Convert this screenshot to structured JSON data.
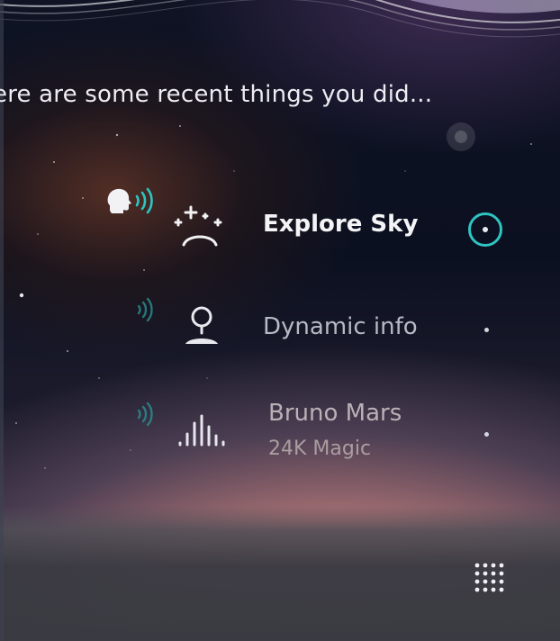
{
  "heading": "ere are some recent things you did...",
  "items": [
    {
      "title": "Explore Sky",
      "icon": "sparkle-smile-icon",
      "active": true
    },
    {
      "title": "Dynamic info",
      "icon": "location-pin-icon",
      "active": false
    },
    {
      "title": "Bruno Mars",
      "subtitle": "24K Magic",
      "icon": "audio-bars-icon",
      "active": false
    }
  ],
  "colors": {
    "accent": "#2ec4c2",
    "text_primary": "#f4f4f6",
    "text_muted": "#b7b9c3"
  },
  "icons": {
    "voice_active": "speaking-head-icon",
    "voice_waves": "sound-waves-icon",
    "launcher": "app-grid-icon"
  }
}
